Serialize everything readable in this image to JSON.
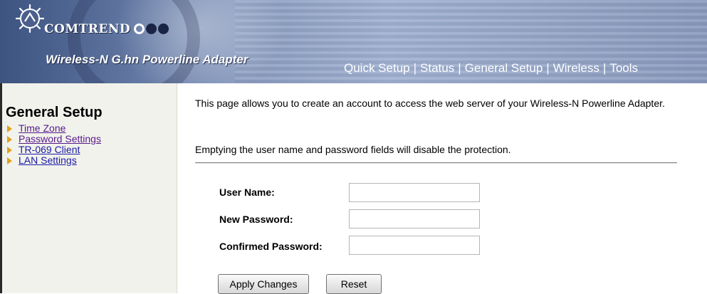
{
  "header": {
    "brand": "COMTREND",
    "product_title": "Wireless-N G.hn Powerline Adapter",
    "nav": [
      {
        "label": "Quick Setup"
      },
      {
        "label": "Status"
      },
      {
        "label": "General Setup"
      },
      {
        "label": "Wireless"
      },
      {
        "label": "Tools"
      }
    ],
    "separator": "|"
  },
  "sidebar": {
    "title": "General Setup",
    "items": [
      {
        "label": "Time Zone",
        "visited": true
      },
      {
        "label": "Password Settings",
        "visited": true
      },
      {
        "label": "TR-069 Client",
        "visited": false
      },
      {
        "label": "LAN Settings",
        "visited": false
      }
    ]
  },
  "main": {
    "description": "This page allows you to create an account to access the web server of your Wireless-N Powerline Adapter.",
    "note": "Emptying the user name and password fields will disable the protection.",
    "fields": {
      "user_name": {
        "label": "User Name:",
        "value": ""
      },
      "new_password": {
        "label": "New Password:",
        "value": ""
      },
      "confirmed_password": {
        "label": "Confirmed Password:",
        "value": ""
      }
    },
    "buttons": {
      "apply": "Apply Changes",
      "reset": "Reset"
    }
  },
  "colors": {
    "link": "#1a1aa6",
    "visited_link": "#551a8b",
    "sidebar_bg": "#f2f2ec",
    "bullet": "#e0a21b",
    "header_dark": "#3d5380"
  }
}
